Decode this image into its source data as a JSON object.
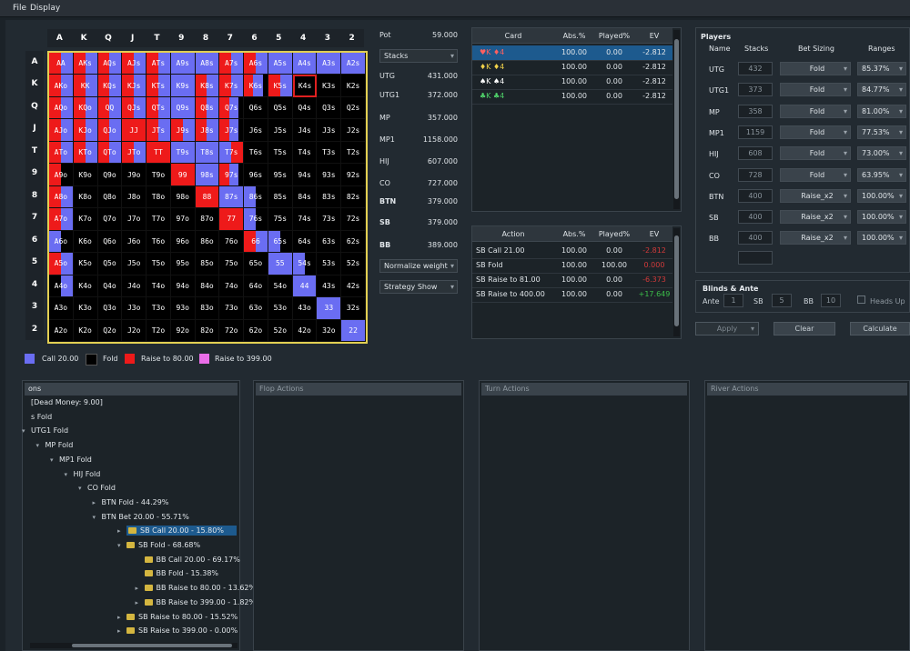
{
  "menu": {
    "file": "File",
    "display": "Display"
  },
  "grid": {
    "ranks": [
      "A",
      "K",
      "Q",
      "J",
      "T",
      "9",
      "8",
      "7",
      "6",
      "5",
      "4",
      "3",
      "2"
    ],
    "rows": [
      [
        "AA",
        "AKs",
        "AQs",
        "AJs",
        "ATs",
        "A9s",
        "A8s",
        "A7s",
        "A6s",
        "A5s",
        "A4s",
        "A3s",
        "A2s"
      ],
      [
        "AKo",
        "KK",
        "KQs",
        "KJs",
        "KTs",
        "K9s",
        "K8s",
        "K7s",
        "K6s",
        "K5s",
        "K4s",
        "K3s",
        "K2s"
      ],
      [
        "AQo",
        "KQo",
        "QQ",
        "QJs",
        "QTs",
        "Q9s",
        "Q8s",
        "Q7s",
        "Q6s",
        "Q5s",
        "Q4s",
        "Q3s",
        "Q2s"
      ],
      [
        "AJo",
        "KJo",
        "QJo",
        "JJ",
        "JTs",
        "J9s",
        "J8s",
        "J7s",
        "J6s",
        "J5s",
        "J4s",
        "J3s",
        "J2s"
      ],
      [
        "ATo",
        "KTo",
        "QTo",
        "JTo",
        "TT",
        "T9s",
        "T8s",
        "T7s",
        "T6s",
        "T5s",
        "T4s",
        "T3s",
        "T2s"
      ],
      [
        "A9o",
        "K9o",
        "Q9o",
        "J9o",
        "T9o",
        "99",
        "98s",
        "97s",
        "96s",
        "95s",
        "94s",
        "93s",
        "92s"
      ],
      [
        "A8o",
        "K8o",
        "Q8o",
        "J8o",
        "T8o",
        "98o",
        "88",
        "87s",
        "86s",
        "85s",
        "84s",
        "83s",
        "82s"
      ],
      [
        "A7o",
        "K7o",
        "Q7o",
        "J7o",
        "T7o",
        "97o",
        "87o",
        "77",
        "76s",
        "75s",
        "74s",
        "73s",
        "72s"
      ],
      [
        "A6o",
        "K6o",
        "Q6o",
        "J6o",
        "T6o",
        "96o",
        "86o",
        "76o",
        "66",
        "65s",
        "64s",
        "63s",
        "62s"
      ],
      [
        "A5o",
        "K5o",
        "Q5o",
        "J5o",
        "T5o",
        "95o",
        "85o",
        "75o",
        "65o",
        "55",
        "54s",
        "53s",
        "52s"
      ],
      [
        "A4o",
        "K4o",
        "Q4o",
        "J4o",
        "T4o",
        "94o",
        "84o",
        "74o",
        "64o",
        "54o",
        "44",
        "43s",
        "42s"
      ],
      [
        "A3o",
        "K3o",
        "Q3o",
        "J3o",
        "T3o",
        "93o",
        "83o",
        "73o",
        "63o",
        "53o",
        "43o",
        "33",
        "32s"
      ],
      [
        "A2o",
        "K2o",
        "Q2o",
        "J2o",
        "T2o",
        "92o",
        "82o",
        "72o",
        "62o",
        "52o",
        "42o",
        "32o",
        "22"
      ]
    ],
    "mix": [
      [
        "RB",
        "RB",
        "RB",
        "RB",
        "RB",
        "B",
        "B",
        "RB",
        "RB",
        "B",
        "B",
        "B",
        "B"
      ],
      [
        "RB",
        "RB",
        "RB",
        "RB",
        "RB",
        "B",
        "RB",
        "RB",
        "RBF",
        "RB",
        "X",
        "F",
        "F"
      ],
      [
        "RB",
        "RB",
        "RB",
        "RB",
        "RB",
        "B",
        "RB",
        "RBF",
        "F",
        "F",
        "F",
        "F",
        "F"
      ],
      [
        "RB",
        "RB",
        "RB",
        "R",
        "RB",
        "RB",
        "RB",
        "RBF",
        "F",
        "F",
        "F",
        "F",
        "F"
      ],
      [
        "RB",
        "RB",
        "RB",
        "RB",
        "R",
        "B",
        "B",
        "BR",
        "F",
        "F",
        "F",
        "F",
        "F"
      ],
      [
        "RF",
        "F",
        "F",
        "F",
        "F",
        "R",
        "B",
        "RBF",
        "F",
        "F",
        "F",
        "F",
        "F"
      ],
      [
        "RB",
        "F",
        "F",
        "F",
        "F",
        "F",
        "R",
        "B",
        "BF",
        "F",
        "F",
        "F",
        "F"
      ],
      [
        "RB",
        "F",
        "F",
        "F",
        "F",
        "F",
        "F",
        "R",
        "BF",
        "F",
        "F",
        "F",
        "F"
      ],
      [
        "BF",
        "F",
        "F",
        "F",
        "F",
        "F",
        "F",
        "F",
        "RB",
        "BF",
        "F",
        "F",
        "F"
      ],
      [
        "RB",
        "F",
        "F",
        "F",
        "F",
        "F",
        "F",
        "F",
        "F",
        "B",
        "BF",
        "F",
        "F"
      ],
      [
        "FB",
        "F",
        "F",
        "F",
        "F",
        "F",
        "F",
        "F",
        "F",
        "F",
        "B",
        "F",
        "F"
      ],
      [
        "F",
        "F",
        "F",
        "F",
        "F",
        "F",
        "F",
        "F",
        "F",
        "F",
        "F",
        "B",
        "F"
      ],
      [
        "F",
        "F",
        "F",
        "F",
        "F",
        "F",
        "F",
        "F",
        "F",
        "F",
        "F",
        "F",
        "B"
      ]
    ]
  },
  "legend": [
    {
      "label": "Call 20.00",
      "color": "#6a6df2"
    },
    {
      "label": "Fold",
      "color": "#000000"
    },
    {
      "label": "Raise to 80.00",
      "color": "#ee1a1a"
    },
    {
      "label": "Raise to 399.00",
      "color": "#ea6de8"
    }
  ],
  "info": {
    "pot_label": "Pot",
    "pot_value": "59.000",
    "stacks_dropdown": "Stacks",
    "positions": [
      {
        "label": "UTG",
        "value": "431.000"
      },
      {
        "label": "UTG1",
        "value": "372.000"
      },
      {
        "label": "MP",
        "value": "357.000"
      },
      {
        "label": "MP1",
        "value": "1158.000"
      },
      {
        "label": "HIJ",
        "value": "607.000"
      },
      {
        "label": "CO",
        "value": "727.000"
      },
      {
        "label": "BTN",
        "value": "379.000"
      },
      {
        "label": "SB",
        "value": "379.000"
      },
      {
        "label": "BB",
        "value": "389.000"
      }
    ],
    "normalize_dropdown": "Normalize weight",
    "strategy_dropdown": "Strategy Show"
  },
  "card_table": {
    "headers": [
      "Card",
      "Abs.%",
      "Played%",
      "EV"
    ],
    "rows": [
      {
        "card": "♥K ♦4",
        "abs": "100.00",
        "played": "0.00",
        "ev": "-2.812"
      },
      {
        "card": "♦K ♦4",
        "abs": "100.00",
        "played": "0.00",
        "ev": "-2.812"
      },
      {
        "card": "♠K ♠4",
        "abs": "100.00",
        "played": "0.00",
        "ev": "-2.812"
      },
      {
        "card": "♣K ♣4",
        "abs": "100.00",
        "played": "0.00",
        "ev": "-2.812"
      }
    ]
  },
  "action_table": {
    "headers": [
      "Action",
      "Abs.%",
      "Played%",
      "EV"
    ],
    "rows": [
      {
        "action": "SB Call 21.00",
        "abs": "100.00",
        "played": "0.00",
        "ev": "-2.812",
        "ev_color": "#d23a3a"
      },
      {
        "action": "SB Fold",
        "abs": "100.00",
        "played": "100.00",
        "ev": "0.000",
        "ev_color": "#d23a3a"
      },
      {
        "action": "SB Raise to 81.00",
        "abs": "100.00",
        "played": "0.00",
        "ev": "-6.373",
        "ev_color": "#d23a3a"
      },
      {
        "action": "SB Raise to 400.00",
        "abs": "100.00",
        "played": "0.00",
        "ev": "+17.649",
        "ev_color": "#3cbf4a"
      }
    ]
  },
  "players": {
    "title": "Players",
    "headers": [
      "Name",
      "Stacks",
      "Bet Sizing",
      "Ranges"
    ],
    "rows": [
      {
        "name": "UTG",
        "stack": "432",
        "bet": "Fold",
        "range": "85.37%"
      },
      {
        "name": "UTG1",
        "stack": "373",
        "bet": "Fold",
        "range": "84.77%"
      },
      {
        "name": "MP",
        "stack": "358",
        "bet": "Fold",
        "range": "81.00%"
      },
      {
        "name": "MP1",
        "stack": "1159",
        "bet": "Fold",
        "range": "77.53%"
      },
      {
        "name": "HIJ",
        "stack": "608",
        "bet": "Fold",
        "range": "73.00%"
      },
      {
        "name": "CO",
        "stack": "728",
        "bet": "Fold",
        "range": "63.95%"
      },
      {
        "name": "BTN",
        "stack": "400",
        "bet": "Raise_x2",
        "range": "100.00%"
      },
      {
        "name": "SB",
        "stack": "400",
        "bet": "Raise_x2",
        "range": "100.00%"
      },
      {
        "name": "BB",
        "stack": "400",
        "bet": "Raise_x2",
        "range": "100.00%"
      }
    ]
  },
  "blinds": {
    "title": "Blinds & Ante",
    "ante_label": "Ante",
    "ante_value": "1",
    "sb_label": "SB",
    "sb_value": "5",
    "bb_label": "BB",
    "bb_value": "10",
    "heads_up": "Heads Up"
  },
  "buttons": {
    "apply": "Apply",
    "clear": "Clear",
    "calculate": "Calculate"
  },
  "streets": {
    "preflop_title": "ons",
    "flop": "Flop Actions",
    "turn": "Turn Actions",
    "river": "River Actions"
  },
  "tree": [
    {
      "text": "[Dead Money: 9.00]",
      "level": 0,
      "arrow": "",
      "folder": false
    },
    {
      "text": "s Fold",
      "level": 0,
      "arrow": "",
      "folder": false
    },
    {
      "text": "UTG1 Fold",
      "level": 0,
      "arrow": "▾",
      "folder": false
    },
    {
      "text": "MP Fold",
      "level": 1,
      "arrow": "▾",
      "folder": false
    },
    {
      "text": "MP1 Fold",
      "level": 2,
      "arrow": "▾",
      "folder": false
    },
    {
      "text": "HIJ Fold",
      "level": 3,
      "arrow": "▾",
      "folder": false
    },
    {
      "text": "CO Fold",
      "level": 4,
      "arrow": "▾",
      "folder": false
    },
    {
      "text": "BTN Fold - 44.29%",
      "level": 5,
      "arrow": "▸",
      "folder": false
    },
    {
      "text": "BTN Bet 20.00 - 55.71%",
      "level": 5,
      "arrow": "▾",
      "folder": false
    },
    {
      "text": "SB Call 20.00 - 15.80%",
      "level": 6,
      "arrow": "▸",
      "folder": true,
      "selected": true
    },
    {
      "text": "SB Fold - 68.68%",
      "level": 6,
      "arrow": "▾",
      "folder": true
    },
    {
      "text": "BB Call 20.00 - 69.17%",
      "level": 7,
      "arrow": "",
      "folder": true
    },
    {
      "text": "BB Fold - 15.38%",
      "level": 7,
      "arrow": "",
      "folder": true
    },
    {
      "text": "BB Raise to 80.00 - 13.62%",
      "level": 7,
      "arrow": "▸",
      "folder": true
    },
    {
      "text": "BB Raise to 399.00 - 1.82%",
      "level": 7,
      "arrow": "▸",
      "folder": true
    },
    {
      "text": "SB Raise to 80.00 - 15.52%",
      "level": 6,
      "arrow": "▸",
      "folder": true
    },
    {
      "text": "SB Raise to 399.00 - 0.00%",
      "level": 6,
      "arrow": "▸",
      "folder": true
    }
  ]
}
